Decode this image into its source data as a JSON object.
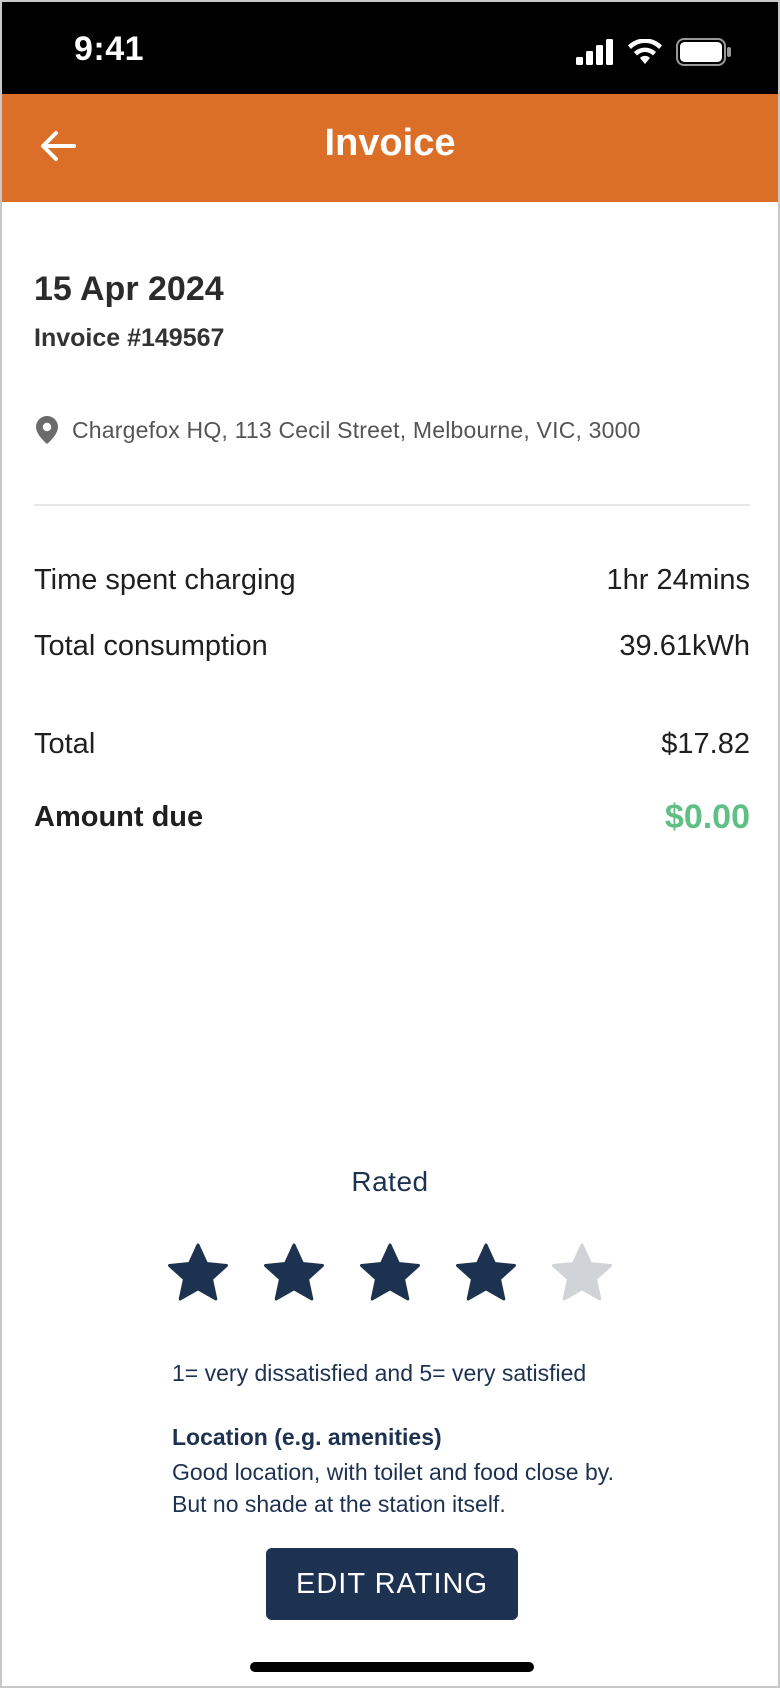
{
  "status_bar": {
    "time": "9:41"
  },
  "header": {
    "title": "Invoice"
  },
  "invoice": {
    "date": "15 Apr 2024",
    "number": "Invoice #149567",
    "location": "Chargefox HQ, 113 Cecil Street, Melbourne, VIC, 3000"
  },
  "details": [
    {
      "label": "Time spent charging",
      "value": "1hr 24mins"
    },
    {
      "label": "Total consumption",
      "value": "39.61kWh"
    }
  ],
  "totals": {
    "total_label": "Total",
    "total_value": "$17.82",
    "due_label": "Amount due",
    "due_value": "$0.00"
  },
  "rating": {
    "label": "Rated",
    "score": 4,
    "max": 5,
    "scale_note": "1= very dissatisfied and 5= very satisfied",
    "comment_title": "Location (e.g. amenities)",
    "comment_text": "Good location, with toilet and food close by. But no shade at the station itself.",
    "edit_label": "EDIT RATING"
  },
  "colors": {
    "header": "#dc6f28",
    "navy": "#1d3150",
    "success": "#5fbf85",
    "star_empty": "#d0d3d8"
  }
}
